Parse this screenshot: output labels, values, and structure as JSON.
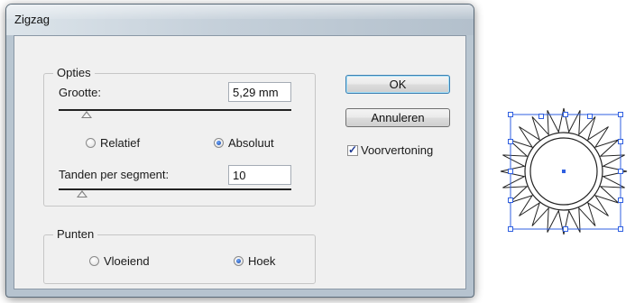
{
  "window": {
    "title": "Zigzag"
  },
  "opties": {
    "legend": "Opties",
    "size_label": "Grootte:",
    "size_value": "5,29 mm",
    "size_slider_level": 0.12,
    "mode_options": [
      {
        "label": "Relatief",
        "selected": false
      },
      {
        "label": "Absoluut",
        "selected": true
      }
    ],
    "ridges_label": "Tanden per segment:",
    "ridges_value": "10",
    "ridges_slider_level": 0.1
  },
  "punten": {
    "legend": "Punten",
    "options": [
      {
        "label": "Vloeiend",
        "selected": false
      },
      {
        "label": "Hoek",
        "selected": true
      }
    ]
  },
  "buttons": {
    "ok": "OK",
    "cancel": "Annuleren"
  },
  "preview": {
    "label": "Voorvertoning",
    "checked": true
  },
  "colors": {
    "selection_blue": "#2f5fe0",
    "shape_stroke": "#222222"
  }
}
